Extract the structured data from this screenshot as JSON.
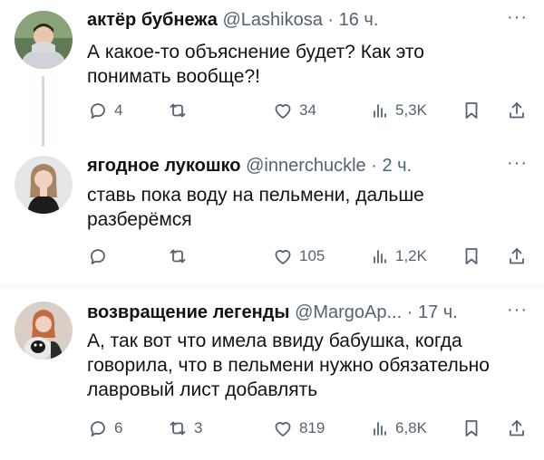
{
  "tweets": [
    {
      "name": "актёр бубнежа",
      "handle": "@Lashikosa",
      "dot": "·",
      "time": "16 ч.",
      "more": "···",
      "text": "А какое-то объяснение будет? Как это понимать вообще?!",
      "replies": "4",
      "retweets": "",
      "likes": "34",
      "views": "5,3K"
    },
    {
      "name": "ягодное лукошко",
      "handle": "@innerchuckle",
      "dot": "·",
      "time": "2 ч.",
      "more": "···",
      "text": "ставь пока воду на пельмени, дальше разберёмся",
      "replies": "",
      "retweets": "",
      "likes": "105",
      "views": "1,2K"
    },
    {
      "name": "возвращение легенды",
      "handle": "@MargoAp...",
      "dot": "·",
      "time": "17 ч.",
      "more": "···",
      "text": "А, так вот что имела ввиду бабушка, когда говорила, что в пельмени нужно обязательно лавровый лист добавлять",
      "replies": "6",
      "retweets": "3",
      "likes": "819",
      "views": "6,8K"
    }
  ],
  "icons": {
    "reply": "reply-icon",
    "retweet": "retweet-icon",
    "like": "heart-icon",
    "views": "views-icon",
    "bookmark": "bookmark-icon",
    "share": "share-icon"
  },
  "colors": {
    "text": "#0f1419",
    "secondary": "#536471",
    "divider": "#eff3f4",
    "thread_line": "#cfd9de"
  }
}
